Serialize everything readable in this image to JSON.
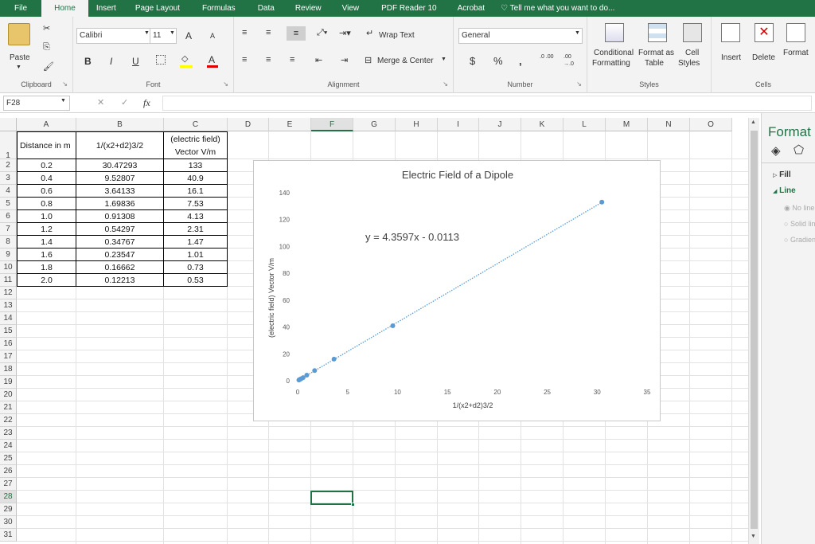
{
  "menu": [
    "File",
    "Home",
    "Insert",
    "Page Layout",
    "Formulas",
    "Data",
    "Review",
    "View",
    "PDF Reader 10",
    "Acrobat"
  ],
  "tellme": "Tell me what you want to do...",
  "ribbon": {
    "clipboard": {
      "paste": "Paste",
      "label": "Clipboard"
    },
    "font": {
      "name": "Calibri",
      "size": "11",
      "bold": "B",
      "italic": "I",
      "underline": "U",
      "grow": "A",
      "shrink": "A",
      "color_glyph": "A",
      "label": "Font"
    },
    "alignment": {
      "wrap": "Wrap Text",
      "merge": "Merge & Center",
      "label": "Alignment"
    },
    "number": {
      "format": "General",
      "currency": "$",
      "percent": "%",
      "comma": ",",
      "inc": ".0 .00",
      "dec": ".00 →.0",
      "label": "Number"
    },
    "styles": {
      "cond1": "Conditional",
      "cond2": "Formatting",
      "fmt1": "Format as",
      "fmt2": "Table",
      "cell1": "Cell",
      "cell2": "Styles",
      "label": "Styles"
    },
    "cells": {
      "insert": "Insert",
      "delete": "Delete",
      "format": "Format",
      "label": "Cells"
    }
  },
  "formula_bar": {
    "name_box": "F28",
    "fx": "fx",
    "content": ""
  },
  "columns": [
    "A",
    "B",
    "C",
    "D",
    "E",
    "F",
    "G",
    "H",
    "I",
    "J",
    "K",
    "L",
    "M",
    "N",
    "O"
  ],
  "rows": [
    "1",
    "2",
    "3",
    "4",
    "5",
    "6",
    "7",
    "8",
    "9",
    "10",
    "11",
    "12",
    "13",
    "14",
    "15",
    "16",
    "17",
    "18",
    "19",
    "20",
    "21",
    "22",
    "23",
    "24",
    "25",
    "26",
    "27",
    "28",
    "29",
    "30",
    "31"
  ],
  "headers": {
    "a": "Distance in m",
    "b": "1/(x2+d2)3/2",
    "c1": "(electric field)",
    "c2": "Vector V/m"
  },
  "table": [
    [
      "0.2",
      "30.47293",
      "133"
    ],
    [
      "0.4",
      "9.52807",
      "40.9"
    ],
    [
      "0.6",
      "3.64133",
      "16.1"
    ],
    [
      "0.8",
      "1.69836",
      "7.53"
    ],
    [
      "1.0",
      "0.91308",
      "4.13"
    ],
    [
      "1.2",
      "0.54297",
      "2.31"
    ],
    [
      "1.4",
      "0.34767",
      "1.47"
    ],
    [
      "1.6",
      "0.23547",
      "1.01"
    ],
    [
      "1.8",
      "0.16662",
      "0.73"
    ],
    [
      "2.0",
      "0.12213",
      "0.53"
    ]
  ],
  "selected_cell": "F28",
  "chart_data": {
    "type": "scatter",
    "title": "Electric Field of a Dipole",
    "xlabel": "1/(x2+d2)3/2",
    "ylabel": "(electric field) Vector V/m",
    "xlim": [
      0,
      35
    ],
    "ylim": [
      0,
      140
    ],
    "xticks": [
      "0",
      "5",
      "10",
      "15",
      "20",
      "25",
      "30",
      "35"
    ],
    "yticks": [
      "0",
      "20",
      "40",
      "60",
      "80",
      "100",
      "120",
      "140"
    ],
    "x": [
      30.47293,
      9.52807,
      3.64133,
      1.69836,
      0.91308,
      0.54297,
      0.34767,
      0.23547,
      0.16662,
      0.12213
    ],
    "y": [
      133,
      40.9,
      16.1,
      7.53,
      4.13,
      2.31,
      1.47,
      1.01,
      0.73,
      0.53
    ],
    "trendline": {
      "slope": 4.3597,
      "intercept": -0.0113,
      "label": "y = 4.3597x - 0.0113"
    },
    "grid": false,
    "colors": {
      "points": "#5b9bd5"
    }
  },
  "format_pane": {
    "title": "Format",
    "fill": "Fill",
    "line": "Line",
    "opt1": "No line",
    "opt2": "Solid line",
    "opt3": "Gradient line"
  },
  "colors": {
    "accent": "#217346",
    "point": "#5b9bd5"
  }
}
